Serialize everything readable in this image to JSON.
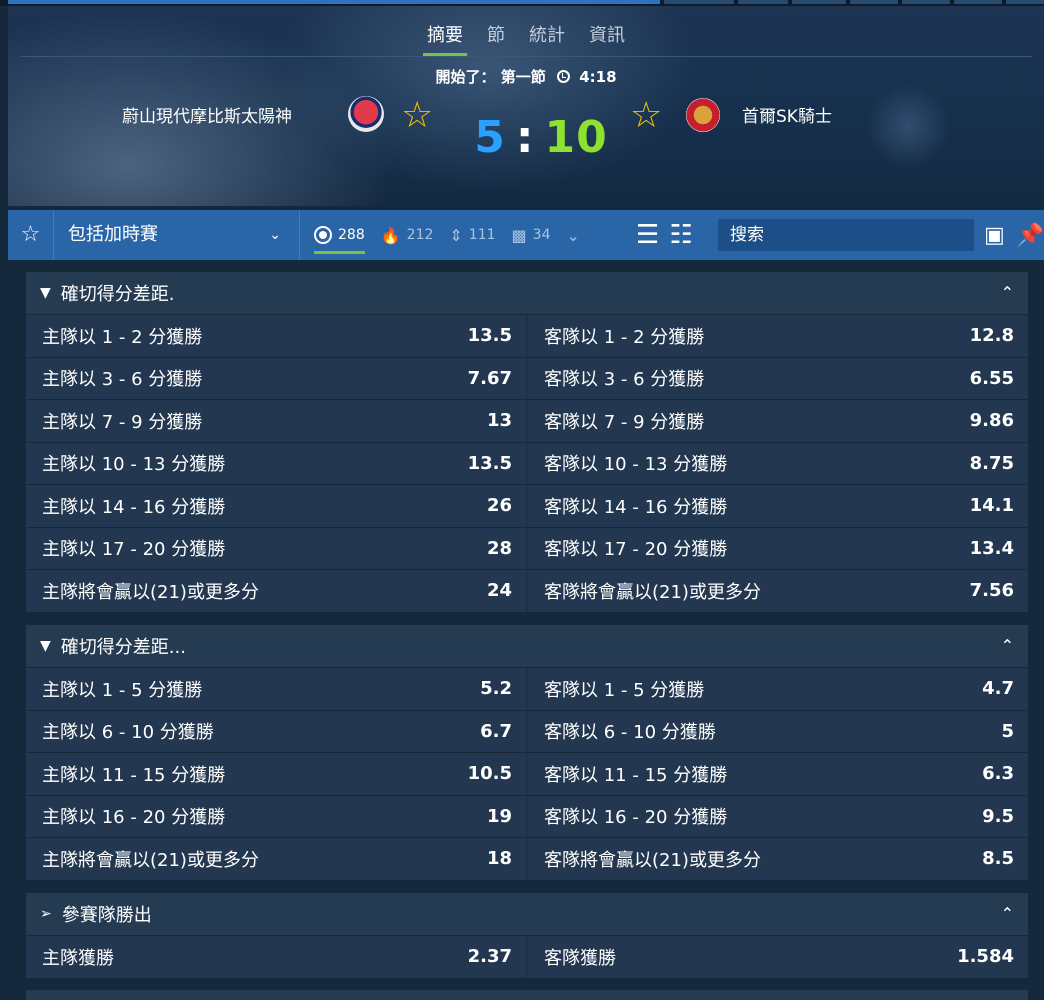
{
  "header": {
    "tabs": [
      "摘要",
      "節",
      "統計",
      "資訊"
    ],
    "status_prefix": "開始了：",
    "period": "第一節",
    "clock_icon": "clock-icon",
    "time": "4:18",
    "home_team": "蔚山現代摩比斯太陽神",
    "away_team": "首爾SK騎士",
    "home_score": "5",
    "score_sep": ":",
    "away_score": "10"
  },
  "toolbar": {
    "filter_label": "包括加時賽",
    "counts": [
      {
        "icon": "target-icon",
        "value": "288"
      },
      {
        "icon": "fire-icon",
        "value": "212"
      },
      {
        "icon": "updown-icon",
        "value": "111"
      },
      {
        "icon": "stats-icon",
        "value": "34"
      }
    ],
    "search_placeholder": "搜索"
  },
  "markets": [
    {
      "title": "確切得分差距.",
      "rows": [
        [
          {
            "label": "主隊以 1 - 2 分獲勝",
            "odd": "13.5"
          },
          {
            "label": "客隊以 1 - 2 分獲勝",
            "odd": "12.8"
          }
        ],
        [
          {
            "label": "主隊以 3 - 6 分獲勝",
            "odd": "7.67"
          },
          {
            "label": "客隊以 3 - 6 分獲勝",
            "odd": "6.55"
          }
        ],
        [
          {
            "label": "主隊以 7 - 9 分獲勝",
            "odd": "13"
          },
          {
            "label": "客隊以 7 - 9 分獲勝",
            "odd": "9.86"
          }
        ],
        [
          {
            "label": "主隊以 10 - 13 分獲勝",
            "odd": "13.5"
          },
          {
            "label": "客隊以 10 - 13 分獲勝",
            "odd": "8.75"
          }
        ],
        [
          {
            "label": "主隊以 14 - 16 分獲勝",
            "odd": "26"
          },
          {
            "label": "客隊以 14 - 16 分獲勝",
            "odd": "14.1"
          }
        ],
        [
          {
            "label": "主隊以 17 - 20 分獲勝",
            "odd": "28"
          },
          {
            "label": "客隊以 17 - 20 分獲勝",
            "odd": "13.4"
          }
        ],
        [
          {
            "label": "主隊將會贏以(21)或更多分",
            "odd": "24"
          },
          {
            "label": "客隊將會贏以(21)或更多分",
            "odd": "7.56"
          }
        ]
      ]
    },
    {
      "title": "確切得分差距...",
      "rows": [
        [
          {
            "label": "主隊以 1 - 5 分獲勝",
            "odd": "5.2"
          },
          {
            "label": "客隊以 1 - 5 分獲勝",
            "odd": "4.7"
          }
        ],
        [
          {
            "label": "主隊以 6 - 10 分獲勝",
            "odd": "6.7"
          },
          {
            "label": "客隊以 6 - 10 分獲勝",
            "odd": "5"
          }
        ],
        [
          {
            "label": "主隊以 11 - 15 分獲勝",
            "odd": "10.5"
          },
          {
            "label": "客隊以 11 - 15 分獲勝",
            "odd": "6.3"
          }
        ],
        [
          {
            "label": "主隊以 16 - 20 分獲勝",
            "odd": "19"
          },
          {
            "label": "客隊以 16 - 20 分獲勝",
            "odd": "9.5"
          }
        ],
        [
          {
            "label": "主隊將會贏以(21)或更多分",
            "odd": "18"
          },
          {
            "label": "客隊將會贏以(21)或更多分",
            "odd": "8.5"
          }
        ]
      ]
    },
    {
      "title": "參賽隊勝出",
      "rows": [
        [
          {
            "label": "主隊獲勝",
            "odd": "2.37"
          },
          {
            "label": "客隊獲勝",
            "odd": "1.584"
          }
        ]
      ]
    }
  ],
  "colors": {
    "accent_green": "#7cc242",
    "home_score": "#2aa0ff",
    "away_score": "#8fe12f",
    "star": "#f6c400",
    "toolbar": "#2a66a7"
  }
}
